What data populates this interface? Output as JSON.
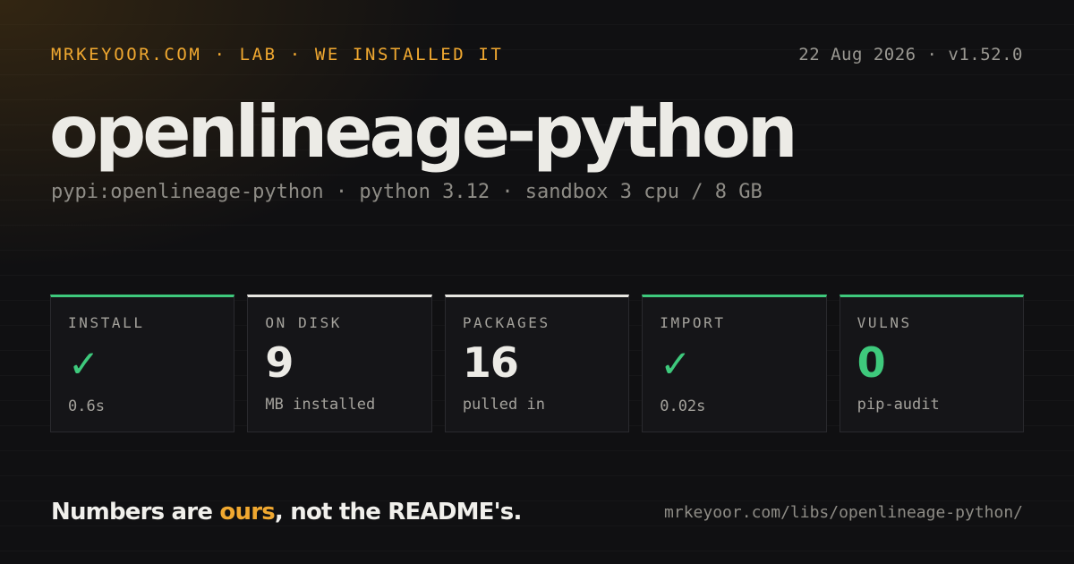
{
  "header": {
    "brand": "MRKEYOOR.COM · LAB · WE INSTALLED IT",
    "meta": "22 Aug 2026 · v1.52.0"
  },
  "title": "openlineage-python",
  "subtitle": "pypi:openlineage-python · python 3.12 · sandbox 3 cpu / 8 GB",
  "cards": [
    {
      "label": "INSTALL",
      "value": "✓",
      "note": "0.6s",
      "accent": "#3ec97c",
      "value_icon": "check-icon"
    },
    {
      "label": "ON DISK",
      "value": "9",
      "note": "MB installed",
      "accent": "#e8e6e1"
    },
    {
      "label": "PACKAGES",
      "value": "16",
      "note": "pulled in",
      "accent": "#e8e6e1"
    },
    {
      "label": "IMPORT",
      "value": "✓",
      "note": "0.02s",
      "accent": "#3ec97c",
      "value_icon": "check-icon"
    },
    {
      "label": "VULNS",
      "value": "0",
      "note": "pip-audit",
      "accent": "#3ec97c"
    }
  ],
  "footer": {
    "tagline_before": "Numbers are ",
    "tagline_accent": "ours",
    "tagline_after": ", not the README's.",
    "url": "mrkeyoor.com/libs/openlineage-python/"
  },
  "colors": {
    "background": "#101012",
    "brand_accent": "#f0a830",
    "success": "#3ec97c",
    "neutral": "#e8e6e1"
  }
}
